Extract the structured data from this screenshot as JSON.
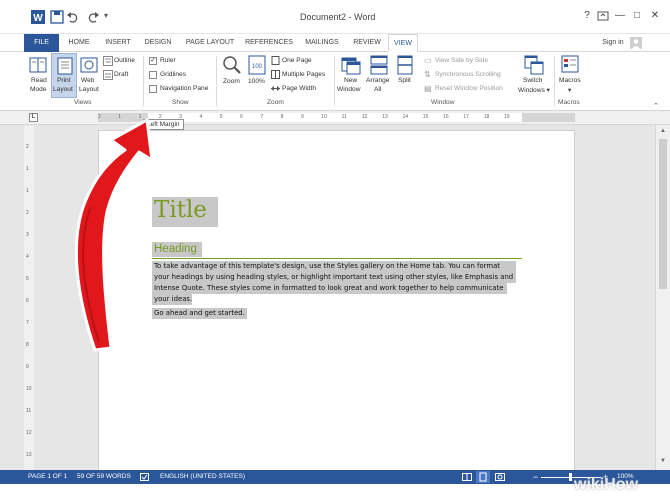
{
  "window": {
    "title": "Document2 - Word",
    "controls": [
      "?",
      "—",
      "□",
      "✕"
    ]
  },
  "quick_access": {
    "icons": [
      "word-logo-icon",
      "save-icon",
      "undo-icon",
      "redo-icon"
    ]
  },
  "tabs": [
    "FILE",
    "HOME",
    "INSERT",
    "DESIGN",
    "PAGE LAYOUT",
    "REFERENCES",
    "MAILINGS",
    "REVIEW",
    "VIEW"
  ],
  "active_tab": "VIEW",
  "signin": "Sign in",
  "ribbon": {
    "views": {
      "group_label": "Views",
      "read_mode": [
        "Read",
        "Mode"
      ],
      "print_layout": [
        "Print",
        "Layout"
      ],
      "web_layout": [
        "Web",
        "Layout"
      ],
      "outline": "Outline",
      "draft": "Draft"
    },
    "show": {
      "group_label": "Show",
      "ruler": "Ruler",
      "gridlines": "Gridlines",
      "navigation_pane": "Navigation Pane"
    },
    "zoom": {
      "group_label": "Zoom",
      "zoom": "Zoom",
      "hundred": "100%",
      "one_page": "One Page",
      "multiple_pages": "Multiple Pages",
      "page_width": "Page Width"
    },
    "window": {
      "group_label": "Window",
      "new_window": [
        "New",
        "Window"
      ],
      "arrange_all": [
        "Arrange",
        "All"
      ],
      "split": "Split",
      "view_side_by_side": "View Side by Side",
      "synchronous_scrolling": "Synchronous Scrolling",
      "reset_window_position": "Reset Window Position",
      "switch_windows": [
        "Switch",
        "Windows ▾"
      ]
    },
    "macros": {
      "group_label": "Macros",
      "macros": "Macros",
      "dropdown": "▾"
    }
  },
  "ruler": {
    "numbers": [
      "2",
      "1",
      "1",
      "2",
      "3",
      "4",
      "5",
      "6",
      "7",
      "8",
      "9",
      "10",
      "11",
      "12",
      "13",
      "14",
      "15",
      "16",
      "17",
      "18",
      "19"
    ],
    "vnumbers": [
      "2",
      "1",
      "1",
      "2",
      "3",
      "4",
      "5",
      "6",
      "7",
      "8",
      "9",
      "10",
      "11",
      "12",
      "13"
    ]
  },
  "tooltip": "Left Margin",
  "document": {
    "title": "Title",
    "heading": "Heading",
    "paragraph_lines": [
      "To take advantage of this template's design, use the Styles gallery on the Home tab. You can format",
      "your headings by using heading styles, or highlight important text using other styles, like Emphasis and",
      "Intense Quote. These styles come in formatted to look great and work together to help communicate",
      "your ideas."
    ],
    "closing": "Go ahead and get started."
  },
  "status_bar": {
    "page": "PAGE 1 OF 1",
    "words": "59 OF 59 WORDS",
    "language": "ENGLISH (UNITED STATES)",
    "zoom": "100%"
  },
  "watermark": "wikiHow",
  "colors": {
    "accent": "#2b579a",
    "heading_green": "#7a9b22",
    "arrow_red": "#e2171c"
  }
}
